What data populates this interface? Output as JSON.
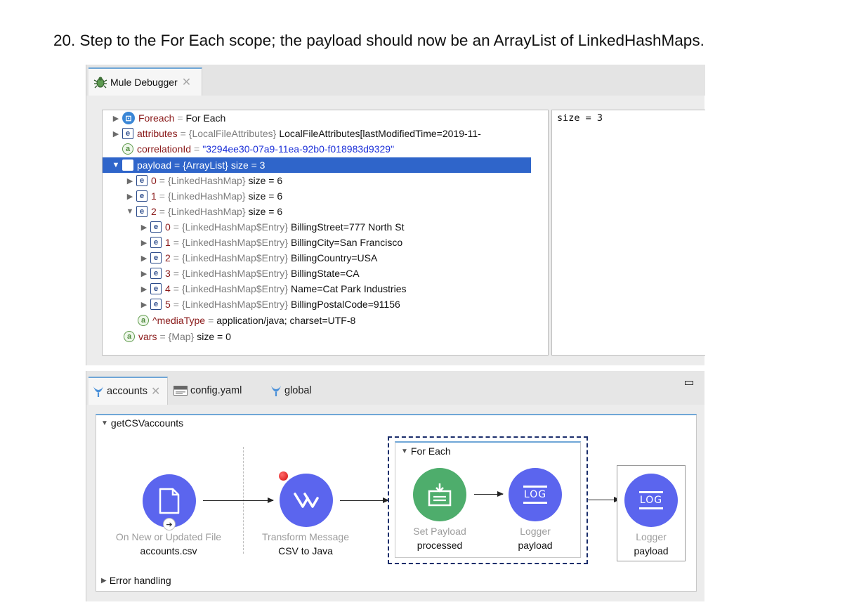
{
  "instruction": "20. Step to the For Each scope; the payload should now be an ArrayList of LinkedHashMaps.",
  "debugger": {
    "tab_label": "Mule Debugger",
    "close": "✕",
    "detail_value": "size = 3",
    "tree": [
      {
        "key": "Foreach",
        "type": "",
        "value": "For Each",
        "icon": "f"
      },
      {
        "key": "attributes",
        "type": "{LocalFileAttributes}",
        "value": "LocalFileAttributes[lastModifiedTime=2019-11-",
        "icon": "e"
      },
      {
        "key": "correlationId",
        "type": "",
        "value": "\"3294ee30-07a9-11ea-92b0-f018983d9329\"",
        "icon": "a"
      },
      {
        "key": "payload",
        "type": "{ArrayList}",
        "value": "size = 3",
        "icon": "e"
      },
      {
        "key": "0",
        "type": "{LinkedHashMap}",
        "value": "size = 6",
        "icon": "e"
      },
      {
        "key": "1",
        "type": "{LinkedHashMap}",
        "value": "size = 6",
        "icon": "e"
      },
      {
        "key": "2",
        "type": "{LinkedHashMap}",
        "value": "size = 6",
        "icon": "e"
      },
      {
        "key": "0",
        "type": "{LinkedHashMap$Entry}",
        "value": "BillingStreet=777 North St",
        "icon": "e"
      },
      {
        "key": "1",
        "type": "{LinkedHashMap$Entry}",
        "value": "BillingCity=San Francisco",
        "icon": "e"
      },
      {
        "key": "2",
        "type": "{LinkedHashMap$Entry}",
        "value": "BillingCountry=USA",
        "icon": "e"
      },
      {
        "key": "3",
        "type": "{LinkedHashMap$Entry}",
        "value": "BillingState=CA",
        "icon": "e"
      },
      {
        "key": "4",
        "type": "{LinkedHashMap$Entry}",
        "value": "Name=Cat Park Industries",
        "icon": "e"
      },
      {
        "key": "5",
        "type": "{LinkedHashMap$Entry}",
        "value": "BillingPostalCode=91156",
        "icon": "e"
      },
      {
        "key": "^mediaType",
        "type": "",
        "value": "application/java; charset=UTF-8",
        "icon": "a"
      },
      {
        "key": "vars",
        "type": "{Map}",
        "value": "size = 0",
        "icon": "a"
      }
    ]
  },
  "editor": {
    "tabs": [
      {
        "label": "accounts"
      },
      {
        "label": "config.yaml"
      },
      {
        "label": "global"
      }
    ],
    "close": "✕",
    "flow_name": "getCSVaccounts",
    "error_handling": "Error handling",
    "scope_name": "For Each",
    "components": {
      "file": {
        "title": "On New or Updated File",
        "subtitle": "accounts.csv"
      },
      "transform": {
        "title": "Transform Message",
        "subtitle": "CSV to Java"
      },
      "set_payload": {
        "title": "Set Payload",
        "subtitle": "processed"
      },
      "logger_inner": {
        "title": "Logger",
        "subtitle": "payload"
      },
      "logger_outer": {
        "title": "Logger",
        "subtitle": "payload"
      }
    },
    "log_text": "LOG"
  },
  "colors": {
    "selection": "#2f65ca",
    "connector": "#5b65ee",
    "set_payload": "#4ead6c",
    "scope_outline": "#1b2e6b",
    "breakpoint": "#d40d0d"
  }
}
